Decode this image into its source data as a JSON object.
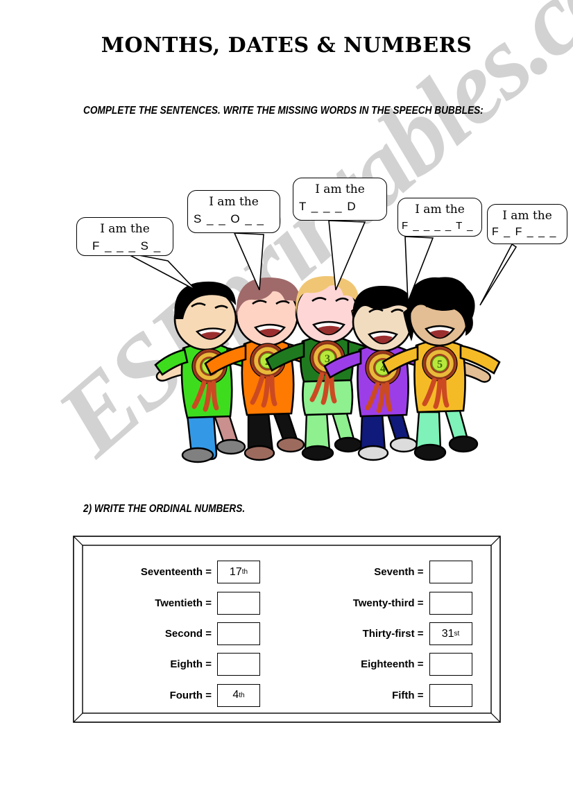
{
  "page": {
    "title": "MONTHS, DATES & NUMBERS",
    "watermark": "ESLprintables.com",
    "background_color": "#ffffff"
  },
  "exercise_1": {
    "instruction": "COMPLETE THE SENTENCES. WRITE THE MISSING WORDS IN THE SPEECH BUBBLES:",
    "bubbles": [
      {
        "id": "bubble-first",
        "line1": "I am the",
        "line2": "F _ _ _ S _",
        "points_to": "kid-1"
      },
      {
        "id": "bubble-second",
        "line1": "I am the",
        "line2": "S _ _ O _ _",
        "points_to": "kid-2"
      },
      {
        "id": "bubble-third",
        "line1": "I am the",
        "line2": "T _ _ _ D",
        "points_to": "kid-3"
      },
      {
        "id": "bubble-fourth",
        "line1": "I am the",
        "line2": "F _ _ _ _ T _",
        "points_to": "kid-4"
      },
      {
        "id": "bubble-fifth",
        "line1": "I am the",
        "line2": "F _ F _ _ _",
        "points_to": "kid-5"
      }
    ],
    "kids": [
      {
        "medal": "1",
        "hair_color": "#000000",
        "shirt_color": "#3ddd1e",
        "pants_color": "#3399e6",
        "shoe_color": "#808080",
        "skin_color": "#f7d9b5"
      },
      {
        "medal": "2",
        "hair_color": "#a06a6a",
        "shirt_color": "#ff7a00",
        "pants_color": "#111111",
        "shoe_color": "#9d6b5e",
        "skin_color": "#ffd3c4"
      },
      {
        "medal": "3",
        "hair_color": "#f0c674",
        "shirt_color": "#1f7a1f",
        "pants_color": "#8ef08e",
        "shoe_color": "#111111",
        "skin_color": "#ffd6d6"
      },
      {
        "medal": "4",
        "hair_color": "#000000",
        "shirt_color": "#9b3ee8",
        "pants_color": "#101a7a",
        "shoe_color": "#dcdcdc",
        "skin_color": "#f2dcc0"
      },
      {
        "medal": "5",
        "hair_color": "#000000",
        "shirt_color": "#f5bb27",
        "pants_color": "#7ef2b8",
        "shoe_color": "#111111",
        "skin_color": "#e3bd93"
      }
    ],
    "medal_colors": {
      "outer_ring": "#a33c20",
      "mid_ring": "#e8b93a",
      "center": "#b8e83a",
      "ribbon": "#cc4a22"
    }
  },
  "exercise_2": {
    "instruction": "2) WRITE THE ORDINAL NUMBERS.",
    "left_column": [
      {
        "label": "Seventeenth =",
        "answer": "17",
        "suffix": "th"
      },
      {
        "label": "Twentieth =",
        "answer": "",
        "suffix": ""
      },
      {
        "label": "Second =",
        "answer": "",
        "suffix": ""
      },
      {
        "label": "Eighth =",
        "answer": "",
        "suffix": ""
      },
      {
        "label": "Fourth =",
        "answer": "4",
        "suffix": "th"
      }
    ],
    "right_column": [
      {
        "label": "Seventh =",
        "answer": "",
        "suffix": ""
      },
      {
        "label": "Twenty-third =",
        "answer": "",
        "suffix": ""
      },
      {
        "label": "Thirty-first =",
        "answer": "31",
        "suffix": "st"
      },
      {
        "label": "Eighteenth =",
        "answer": "",
        "suffix": ""
      },
      {
        "label": "Fifth =",
        "answer": "",
        "suffix": ""
      }
    ]
  }
}
